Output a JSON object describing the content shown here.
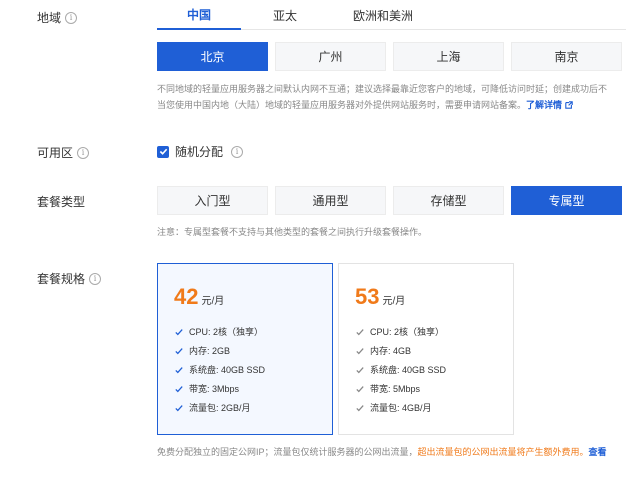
{
  "region": {
    "label": "地域",
    "tabs": [
      "中国",
      "亚太",
      "欧洲和美洲"
    ],
    "active_tab": 0,
    "cities": [
      "北京",
      "广州",
      "上海",
      "南京"
    ],
    "selected_city": 0,
    "note1": "不同地域的轻量应用服务器之间默认内网不互通；建议选择最靠近您客户的地域，可降低访问时延；创建成功后不",
    "note2": "当您使用中国内地（大陆）地域的轻量应用服务器对外提供网站服务时，需要申请网站备案。",
    "note2_link": "了解详情"
  },
  "zone": {
    "label": "可用区",
    "checkbox_label": "随机分配",
    "checked": true
  },
  "plan_type": {
    "label": "套餐类型",
    "options": [
      "入门型",
      "通用型",
      "存储型",
      "专属型"
    ],
    "selected": 3,
    "note": "注意：专属型套餐不支持与其他类型的套餐之间执行升级套餐操作。"
  },
  "spec": {
    "label": "套餐规格",
    "selected": 0,
    "cards": [
      {
        "price": "42",
        "unit": "元/月",
        "features": [
          "CPU: 2核（独享）",
          "内存: 2GB",
          "系统盘: 40GB SSD",
          "带宽: 3Mbps",
          "流量包: 2GB/月"
        ]
      },
      {
        "price": "53",
        "unit": "元/月",
        "features": [
          "CPU: 2核（独享）",
          "内存: 4GB",
          "系统盘: 40GB SSD",
          "带宽: 5Mbps",
          "流量包: 4GB/月"
        ]
      }
    ],
    "footer_text": "免费分配独立的固定公网IP；流量包仅统计服务器的公网出流量，",
    "footer_warn": "超出流量包的公网出流量将产生额外费用。",
    "footer_link": "查看"
  },
  "colors": {
    "primary": "#1f5fd6",
    "price": "#f07a1a",
    "selected_card_bg": "#f4f8ff"
  },
  "icons": {
    "info": "info-circle-icon",
    "check": "check-icon",
    "external": "external-link-icon",
    "checkbox": "checkbox-checked-icon"
  }
}
